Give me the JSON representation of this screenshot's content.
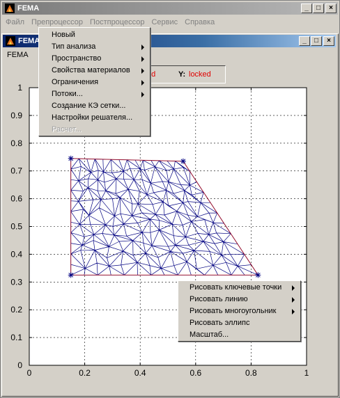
{
  "outer_window": {
    "title": "FEMA",
    "menu": [
      "Файл",
      "Препроцессор",
      "Постпроцессор",
      "Сервис",
      "Справка"
    ]
  },
  "inner_window": {
    "title": "FEMA",
    "menu": [
      "FEMA"
    ]
  },
  "title_buttons": {
    "minimize": "_",
    "maximize": "□",
    "close": "×"
  },
  "coords": {
    "x_status": "ed",
    "y_label": "Y:",
    "y_status": "locked",
    "status_color": "#e00000"
  },
  "preprocessor_menu": [
    {
      "label": "Новый",
      "submenu": false,
      "enabled": true
    },
    {
      "label": "Тип анализа",
      "submenu": true,
      "enabled": true
    },
    {
      "label": "Пространство",
      "submenu": true,
      "enabled": true
    },
    {
      "label": "Свойства материалов",
      "submenu": true,
      "enabled": true
    },
    {
      "label": "Ограничения",
      "submenu": true,
      "enabled": true
    },
    {
      "label": "Потоки...",
      "submenu": true,
      "enabled": true
    },
    {
      "label": "Создание КЭ сетки...",
      "submenu": false,
      "enabled": true
    },
    {
      "label": "Настройки решателя...",
      "submenu": false,
      "enabled": true
    },
    {
      "label": "Расчет...",
      "submenu": false,
      "enabled": false
    }
  ],
  "context_menu": [
    {
      "label": "Рисовать ключевые точки",
      "submenu": true
    },
    {
      "label": "Рисовать линию",
      "submenu": true
    },
    {
      "label": "Рисовать многоугольник",
      "submenu": true
    },
    {
      "label": "Рисовать эллипс",
      "submenu": false
    },
    {
      "label": "Масштаб...",
      "submenu": false
    }
  ],
  "plot": {
    "x_ticks": [
      "0",
      "0.2",
      "0.4",
      "0.6",
      "0.8",
      "1"
    ],
    "y_ticks": [
      "0",
      "0.1",
      "0.2",
      "0.3",
      "0.4",
      "0.5",
      "0.6",
      "0.7",
      "0.8",
      "0.9",
      "1"
    ],
    "xlim": [
      0,
      1
    ],
    "ylim": [
      0,
      1
    ],
    "grid": true,
    "mesh_color": "#000080",
    "boundary_color": "#c00000",
    "keypoints": [
      {
        "x": 0.15,
        "y": 0.745
      },
      {
        "x": 0.555,
        "y": 0.735
      },
      {
        "x": 0.825,
        "y": 0.325
      },
      {
        "x": 0.15,
        "y": 0.325
      }
    ]
  }
}
